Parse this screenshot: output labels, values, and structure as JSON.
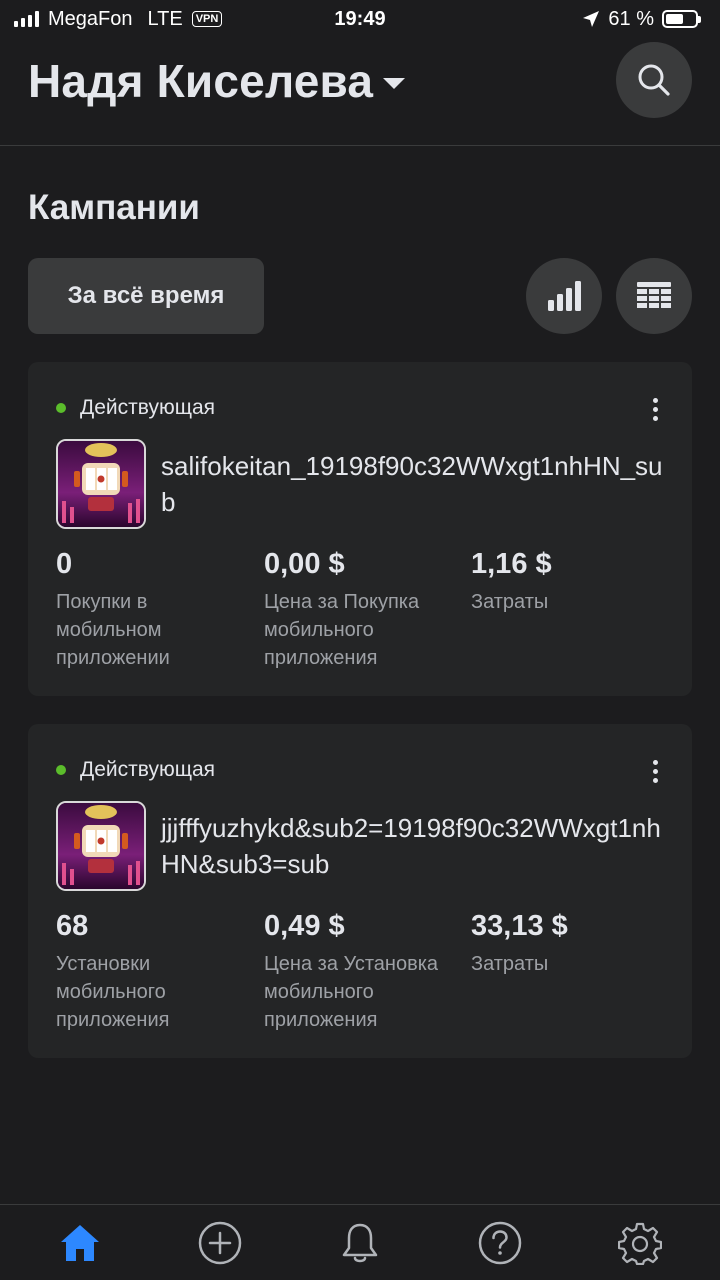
{
  "status_bar": {
    "carrier": "MegaFon",
    "network": "LTE",
    "vpn": "VPN",
    "time": "19:49",
    "battery": "61 %",
    "battery_level": 0.61
  },
  "header": {
    "account_name": "Надя Киселева"
  },
  "section": {
    "title": "Кампании",
    "period_button": "За всё время"
  },
  "campaigns": [
    {
      "status": "Действующая",
      "status_color": "#5bbd2b",
      "name": "salifokeitan_19198f90c32WWxgt1nhHN_sub",
      "metrics": [
        {
          "value": "0",
          "label": "Покупки в\nмобильном\nприложении"
        },
        {
          "value": "0,00 $",
          "label": "Цена за Покупка\nмобильного\nприложения"
        },
        {
          "value": "1,16 $",
          "label": "Затраты"
        }
      ]
    },
    {
      "status": "Действующая",
      "status_color": "#5bbd2b",
      "name": "jjjfffyuzhykd&sub2=19198f90c32WWxgt1nhHN&sub3=sub",
      "metrics": [
        {
          "value": "68",
          "label": "Установки\nмобильного\nприложения"
        },
        {
          "value": "0,49 $",
          "label": "Цена за Установка\nмобильного\nприложения"
        },
        {
          "value": "33,13 $",
          "label": "Затраты"
        }
      ]
    }
  ],
  "nav": {
    "items": [
      "home-icon",
      "add-icon",
      "bell-icon",
      "help-icon",
      "gear-icon"
    ],
    "active_color": "#2d88ff"
  }
}
